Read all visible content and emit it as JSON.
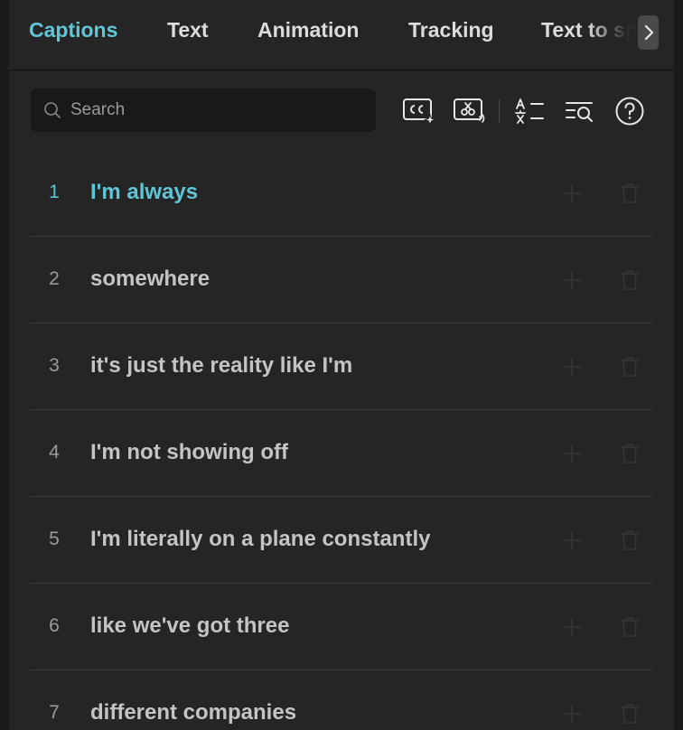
{
  "tabs": [
    {
      "label": "Captions",
      "active": true
    },
    {
      "label": "Text",
      "active": false
    },
    {
      "label": "Animation",
      "active": false
    },
    {
      "label": "Tracking",
      "active": false
    },
    {
      "label": "Text to speech",
      "active": false
    }
  ],
  "search": {
    "placeholder": "Search",
    "value": ""
  },
  "toolbar": {
    "icons": [
      "auto-captions-icon",
      "audio-to-text-icon",
      "translate-icon",
      "find-replace-icon",
      "help-icon"
    ]
  },
  "captions": [
    {
      "index": "1",
      "text": "I'm always",
      "active": true
    },
    {
      "index": "2",
      "text": "somewhere",
      "active": false
    },
    {
      "index": "3",
      "text": "it's just the reality like I'm",
      "active": false
    },
    {
      "index": "4",
      "text": "I'm not showing off",
      "active": false
    },
    {
      "index": "5",
      "text": "I'm literally on a plane constantly",
      "active": false
    },
    {
      "index": "6",
      "text": "like we've got three",
      "active": false
    },
    {
      "index": "7",
      "text": "different companies",
      "active": false
    }
  ],
  "colors": {
    "accent": "#5fc6d6",
    "panel": "#252526",
    "text": "#c4c4c4"
  }
}
